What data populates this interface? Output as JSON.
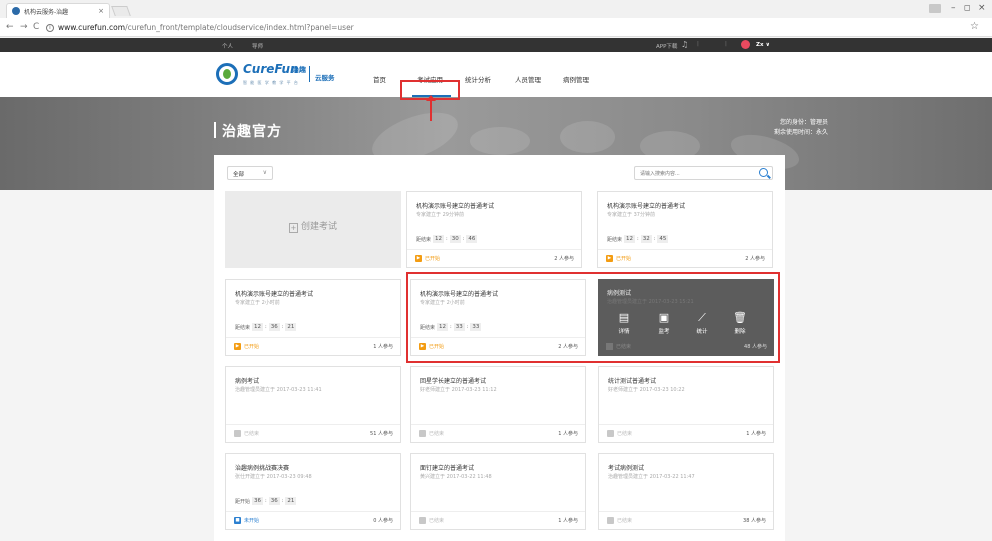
{
  "browser": {
    "tab_title": "机构云服务-治趣",
    "url_host": "www.curefun.com",
    "url_path": "/curefun_front/template/cloudservice/index.html?panel=user"
  },
  "topbar": {
    "left_links": [
      "个人",
      "导师"
    ],
    "app_download": "APP下载",
    "user_label": "Zx"
  },
  "header": {
    "logo_text": "CureFun",
    "logo_cn": "治趣",
    "logo_sub": "智 能 医 学 教 学 平 台",
    "cloud_label": "云服务",
    "nav": [
      {
        "label": "首页",
        "active": false
      },
      {
        "label": "考试应用",
        "active": true
      },
      {
        "label": "统计分析",
        "active": false
      },
      {
        "label": "人员管理",
        "active": false
      },
      {
        "label": "病例管理",
        "active": false
      }
    ]
  },
  "banner": {
    "title": "治趣官方",
    "role": "您的身份：管理员",
    "remain": "剩余使用时间：永久"
  },
  "panel": {
    "filter_value": "全部",
    "search_placeholder": "请输入搜索内容...",
    "create_label": "创建考试",
    "countdown_label": "距结束",
    "countdown_label_start": "距开始",
    "cards": [
      {
        "title": "机构演示账号建立的普通考试",
        "sub": "专家建立于 29分钟前",
        "time": [
          "12",
          "30",
          "46"
        ],
        "status": "已开始",
        "count": "2 人参与"
      },
      {
        "title": "机构演示账号建立的普通考试",
        "sub": "专家建立于 37分钟前",
        "time": [
          "12",
          "32",
          "45"
        ],
        "status": "已开始",
        "count": "2 人参与"
      },
      {
        "title": "机构演示账号建立的普通考试",
        "sub": "专家建立于 2小时前",
        "time": [
          "12",
          "36",
          "21"
        ],
        "status": "已开始",
        "count": "1 人参与"
      },
      {
        "title": "机构演示账号建立的普通考试",
        "sub": "专家建立于 2小时前",
        "time": [
          "12",
          "33",
          "33"
        ],
        "status": "已开始",
        "count": "2 人参与"
      },
      {
        "title": "病例测试",
        "sub": "治趣管理员建立于 2017-03-23 15:21",
        "status": "已结束",
        "count": "48 人参与",
        "actions": [
          {
            "icon": "详情",
            "label": "详情"
          },
          {
            "icon": "监考",
            "label": "监考"
          },
          {
            "icon": "统计",
            "label": "统计"
          },
          {
            "icon": "删除",
            "label": "删除"
          }
        ]
      },
      {
        "title": "病例考试",
        "sub": "治趣管理员建立于 2017-03-23 11:41",
        "status": "已结束",
        "count": "51 人参与"
      },
      {
        "title": "回星学长建立的普通考试",
        "sub": "好老师建立于 2017-03-23 11:12",
        "status": "已结束",
        "count": "1 人参与"
      },
      {
        "title": "统计测试普通考试",
        "sub": "好老师建立于 2017-03-23 10:22",
        "status": "已结束",
        "count": "1 人参与"
      },
      {
        "title": "治趣病例挑战赛决赛",
        "sub": "张仕开建立于 2017-03-23 09:48",
        "time": [
          "36",
          "36",
          "21"
        ],
        "status": "未开始",
        "count": "0 人参与"
      },
      {
        "title": "面钉建立的普通考试",
        "sub": "黄兴建立于 2017-03-22 11:48",
        "status": "已结束",
        "count": "1 人参与"
      },
      {
        "title": "考试病例测试",
        "sub": "治趣管理员建立于 2017-03-22 11:47",
        "status": "已结束",
        "count": "38 人参与"
      }
    ]
  },
  "colors": {
    "brand": "#1c6fb8",
    "started": "#f39c12",
    "not_started": "#2a7fd0",
    "ended": "#c8c8c8",
    "highlight": "#e03030"
  }
}
